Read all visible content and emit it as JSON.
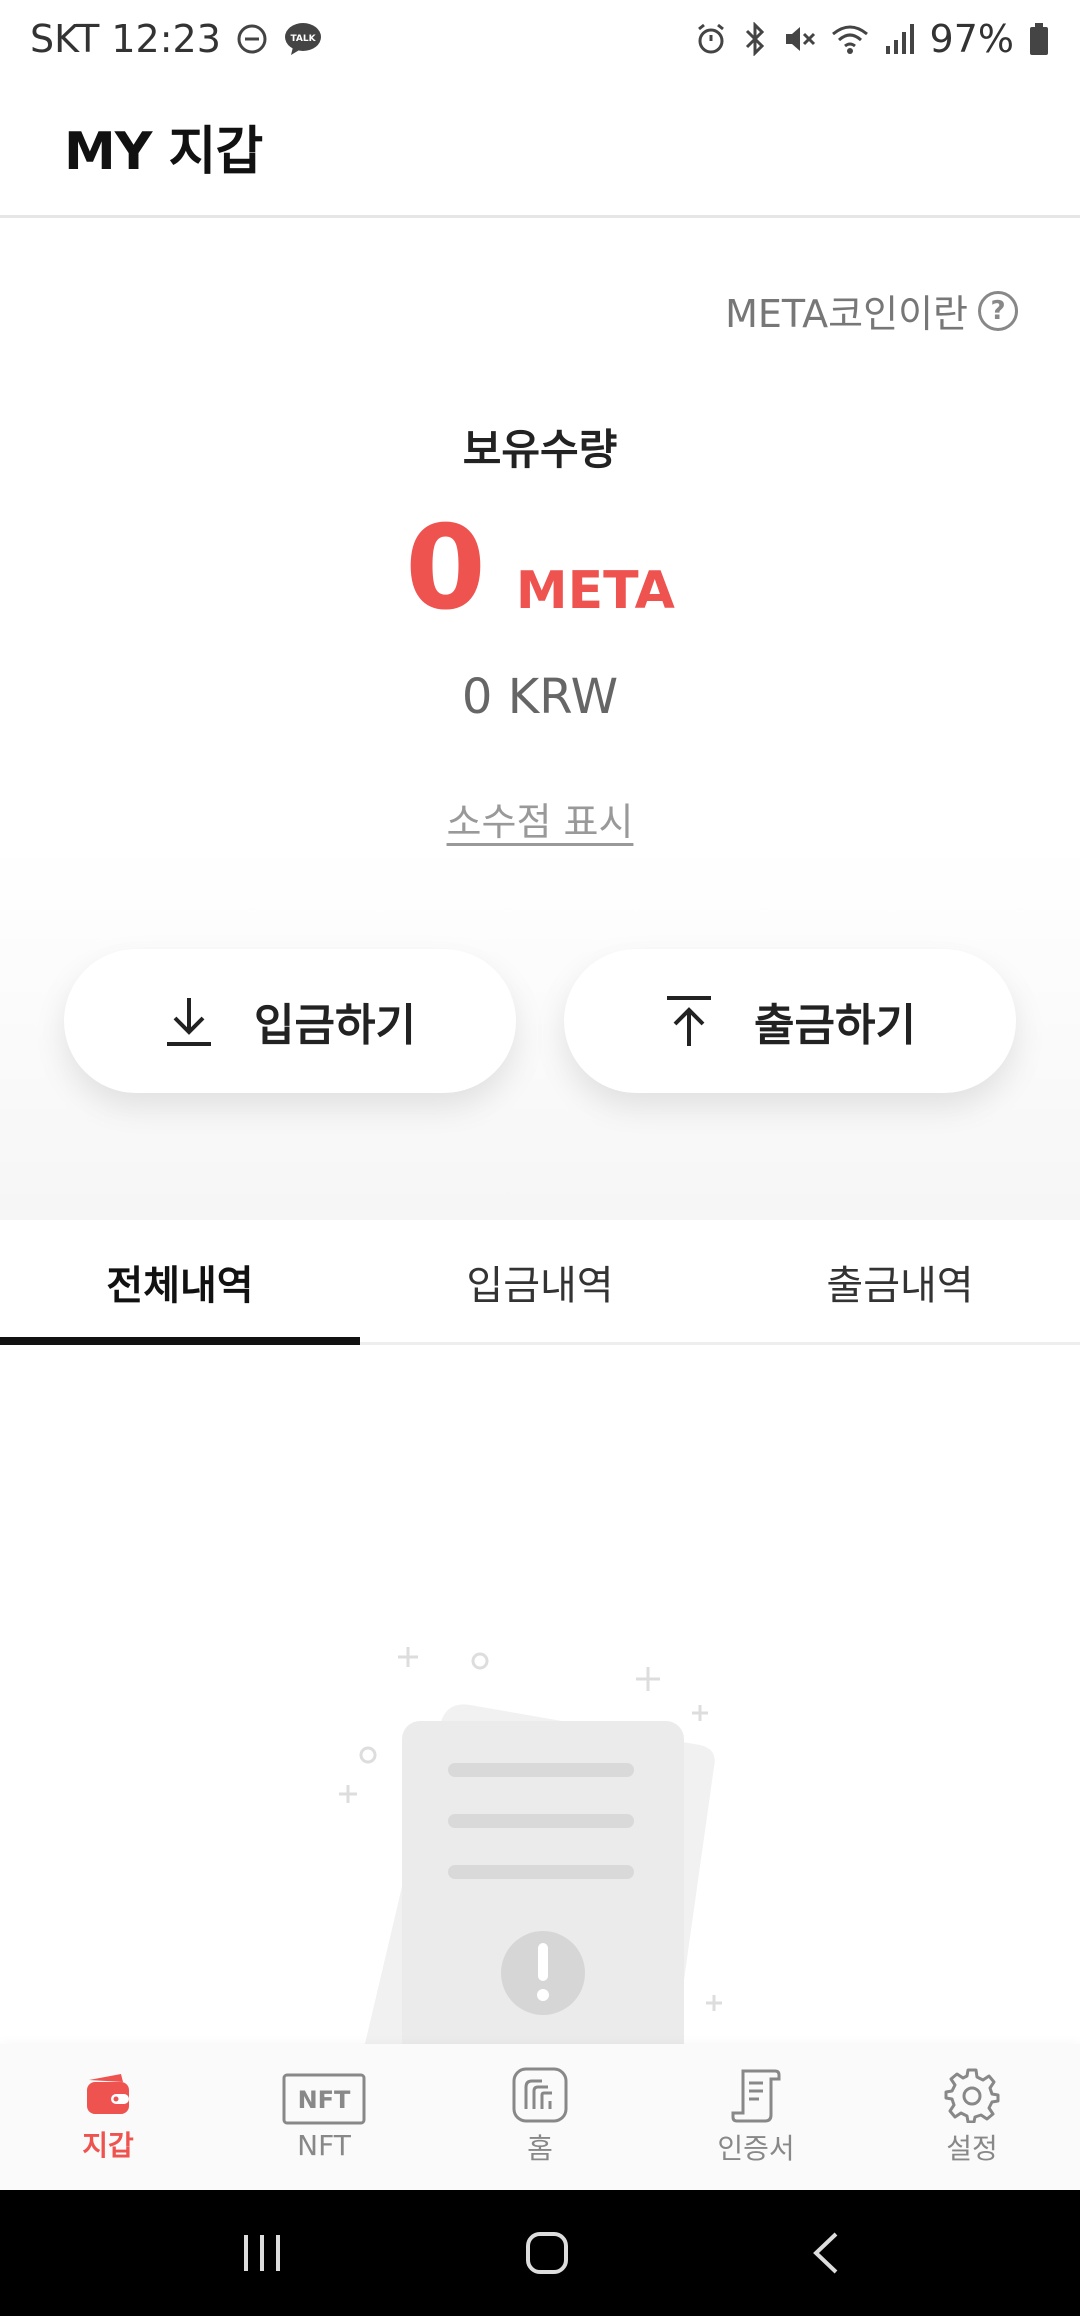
{
  "status_bar": {
    "carrier_time": "SKT 12:23",
    "battery": "97%"
  },
  "header": {
    "title": "MY 지갑"
  },
  "balance": {
    "meta_info_link": "META코인이란",
    "help_symbol": "?",
    "holding_label": "보유수량",
    "amount": "0",
    "unit": "META",
    "krw_value": "0 KRW",
    "decimal_toggle": "소수점 표시"
  },
  "actions": {
    "deposit": "입금하기",
    "withdraw": "출금하기"
  },
  "tabs": [
    {
      "label": "전체내역",
      "active": true
    },
    {
      "label": "입금내역",
      "active": false
    },
    {
      "label": "출금내역",
      "active": false
    }
  ],
  "bottom_nav": [
    {
      "label": "지갑",
      "icon": "wallet-icon",
      "active": true
    },
    {
      "label": "NFT",
      "icon": "nft-icon",
      "active": false
    },
    {
      "label": "홈",
      "icon": "home-icon",
      "active": false
    },
    {
      "label": "인증서",
      "icon": "certificate-icon",
      "active": false
    },
    {
      "label": "설정",
      "icon": "settings-icon",
      "active": false
    }
  ],
  "nft_badge_text": "NFT",
  "colors": {
    "accent": "#ef5350",
    "text_dark": "#222222",
    "text_muted": "#888888"
  }
}
